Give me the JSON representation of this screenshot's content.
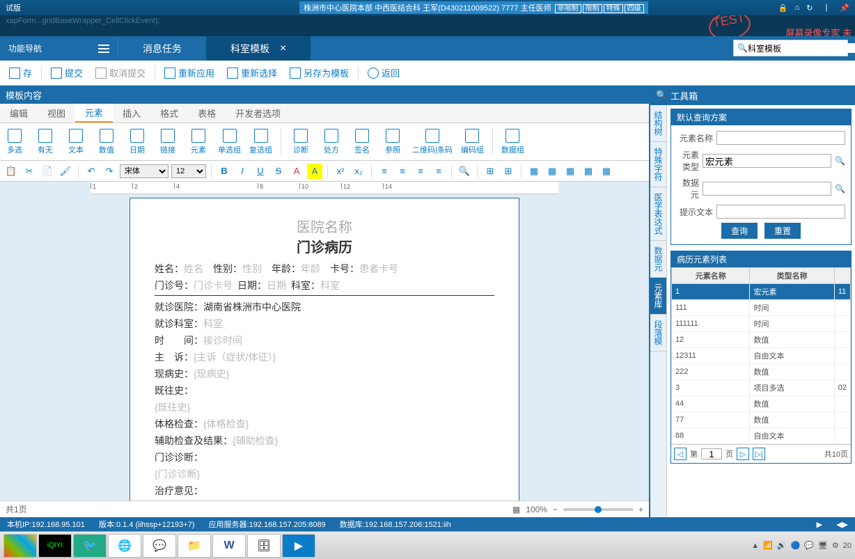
{
  "top": {
    "left_badge": "试版",
    "hospital": "株洲市中心医院本部",
    "dept": "中西医结合科",
    "doctor": "王军(D430211009522)",
    "code": "7777",
    "role": "主任医师",
    "tags": [
      "非限制",
      "限制",
      "特殊",
      "四级"
    ],
    "rec_label": "屏幕录像专家 未",
    "code_lines": "xapForm...gridBaseWrapper_CellClickEvent);"
  },
  "nav": {
    "title": "功能导航"
  },
  "tabs": [
    {
      "label": "消息任务",
      "active": false
    },
    {
      "label": "科室模板",
      "active": true
    }
  ],
  "search": {
    "icon": "🔍",
    "value": "科室模板"
  },
  "toolbar": [
    {
      "label": "存",
      "gray": false
    },
    {
      "label": "提交",
      "gray": false
    },
    {
      "label": "取消提交",
      "gray": true
    },
    {
      "label": "重新应用",
      "gray": false
    },
    {
      "label": "重新选择",
      "gray": false
    },
    {
      "label": "另存为模板",
      "gray": false
    },
    {
      "label": "返回",
      "gray": false
    }
  ],
  "content_header": "模板内容",
  "menu_tabs": [
    "编辑",
    "视图",
    "元素",
    "插入",
    "格式",
    "表格",
    "开发者选项"
  ],
  "menu_active": 2,
  "ribbon": [
    "多选",
    "有无",
    "文本",
    "数值",
    "日期",
    "链接",
    "元素",
    "单选组",
    "复选组",
    "",
    "诊断",
    "处方",
    "签名",
    "参照",
    "二维码|条码",
    "编码组",
    "",
    "数据组"
  ],
  "format": {
    "font": "宋体",
    "size": "12"
  },
  "doc": {
    "hospital_name": "医院名称",
    "title": "门诊病历",
    "fields": {
      "name_l": "姓名：",
      "name_ph": "姓名",
      "sex_l": "性别：",
      "sex_ph": "性别",
      "age_l": "年龄：",
      "age_ph": "年龄",
      "card_l": "卡号：",
      "card_ph": "患者卡号",
      "opno_l": "门诊号：",
      "opno_ph": "门诊卡号",
      "date_l": "日期：",
      "date_ph": "日期",
      "dept_l": "科室：",
      "dept_ph": "科室",
      "vhosp_l": "就诊医院：",
      "vhosp_v": "湖南省株洲市中心医院",
      "vdept_l": "就诊科室：",
      "vdept_ph": "科室",
      "time_l": "时　　间：",
      "time_ph": "接诊时间",
      "chief_l": "主　诉：",
      "chief_ph": "{主诉（症状/体征）}",
      "hpi_l": "现病史：",
      "hpi_ph": "{现病史}",
      "ph_l": "既往史：",
      "ph_ph": "{既往史}",
      "pe_l": "体格检查：",
      "pe_ph": "{体格检查}",
      "aux_l": "辅助检查及结果：",
      "aux_ph": "{辅助检查}",
      "diag_l": "门诊诊断：",
      "diag_ph": "{门诊诊断}",
      "plan_l": "治疗意见："
    }
  },
  "status": {
    "pages": "共1页",
    "zoom": "100%"
  },
  "toolbox": {
    "title": "工具箱",
    "vtabs": [
      "结构树",
      "特殊字符",
      "医学表达式",
      "数据元",
      "元素库",
      "段落模"
    ],
    "vactive": 4,
    "query": {
      "title": "默认查询方案",
      "name_l": "元素名称",
      "type_l": "元素类型",
      "type_v": "宏元素",
      "de_l": "数据元",
      "hint_l": "提示文本",
      "btn_query": "查询",
      "btn_reset": "重置"
    },
    "list": {
      "title": "病历元素列表",
      "cols": [
        "元素名称",
        "类型名称",
        ""
      ],
      "rows": [
        {
          "name": "1",
          "type": "宏元素",
          "extra": "11",
          "sel": true
        },
        {
          "name": "111",
          "type": "时间"
        },
        {
          "name": "111111",
          "type": "时间"
        },
        {
          "name": "12",
          "type": "数值"
        },
        {
          "name": "12311",
          "type": "自由文本"
        },
        {
          "name": "222",
          "type": "数值"
        },
        {
          "name": "3",
          "type": "项目多选",
          "extra": "02"
        },
        {
          "name": "44",
          "type": "数值"
        },
        {
          "name": "77",
          "type": "数值"
        },
        {
          "name": "88",
          "type": "自由文本"
        }
      ],
      "pager": {
        "cur": "1",
        "label_pre": "第",
        "label_post": "页",
        "total": "共10页"
      }
    }
  },
  "bottom": {
    "ip": "本机IP:192.168.95.101",
    "ver": "版本:0.1.4 (iihssp+12193+7)",
    "app": "应用服务器:192.168.157.205:8089",
    "db": "数据库:192.168.157.206:1521:iih"
  },
  "tray_time": "20"
}
